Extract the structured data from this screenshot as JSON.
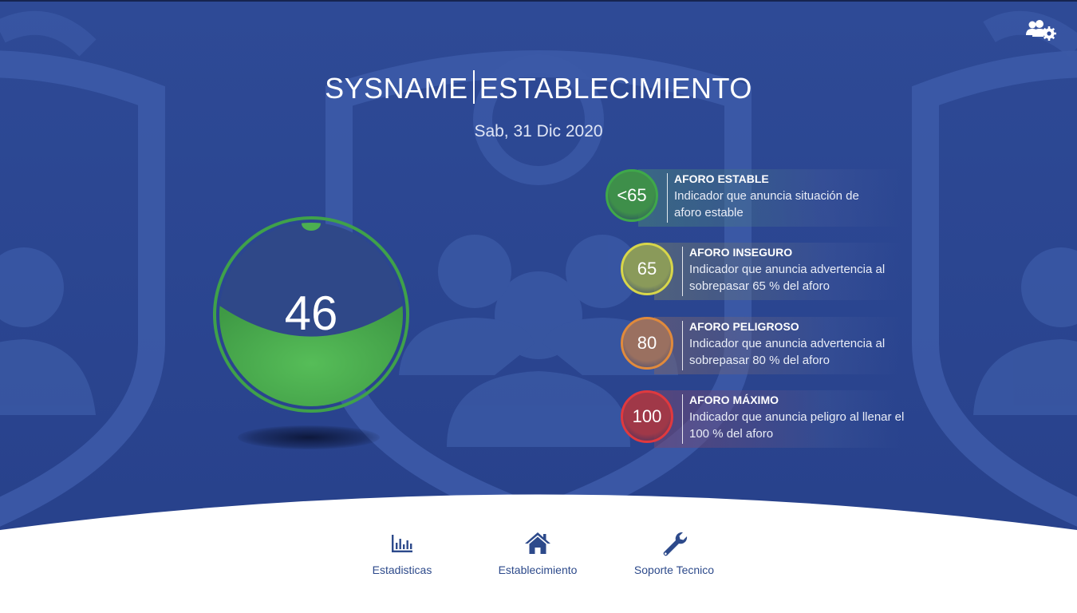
{
  "header": {
    "brand": "SYSNAME",
    "section": "ESTABLECIMIENTO",
    "date": "Sab, 31 Dic 2020"
  },
  "gauge": {
    "value": "46",
    "fill_fraction": 0.46,
    "fill_color": "#4caf50",
    "ring_color": "#3fa14a"
  },
  "levels": [
    {
      "badge": "<65",
      "title": "AFORO ESTABLE",
      "desc": "Indicador que anuncia situación de aforo estable",
      "color": "#3fa84a"
    },
    {
      "badge": "65",
      "title": "AFORO INSEGURO",
      "desc": "Indicador que anuncia advertencia al sobrepasar 65 % del aforo",
      "color": "#d7d64a"
    },
    {
      "badge": "80",
      "title": "AFORO PELIGROSO",
      "desc": "Indicador que anuncia advertencia al sobrepasar 80 % del aforo",
      "color": "#e08a3c"
    },
    {
      "badge": "100",
      "title": "AFORO MÁXIMO",
      "desc": "Indicador que anuncia peligro al llenar el 100 % del aforo",
      "color": "#e0393e"
    }
  ],
  "nav": [
    {
      "label": "Estadisticas",
      "icon": "bar-chart-icon"
    },
    {
      "label": "Establecimiento",
      "icon": "home-icon"
    },
    {
      "label": "Soporte Tecnico",
      "icon": "wrench-icon"
    }
  ],
  "colors": {
    "background": "#2b4590",
    "footer": "#ffffff",
    "nav_text": "#2d4a8b"
  }
}
